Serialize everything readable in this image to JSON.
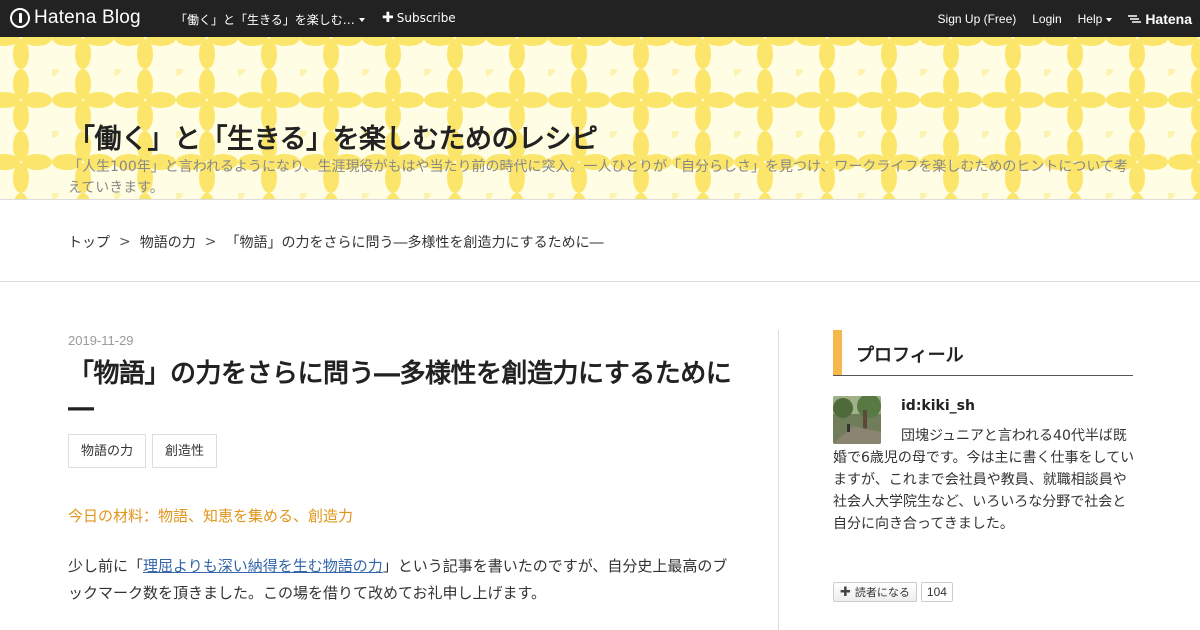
{
  "topbar": {
    "brand": "Hatena Blog",
    "blog_select": "「働く」と「生きる」を楽しむ…",
    "subscribe": "Subscribe",
    "signup": "Sign Up (Free)",
    "login": "Login",
    "help": "Help",
    "hatena": "Hatena"
  },
  "header": {
    "title": "「働く」と「生きる」を楽しむためのレシピ",
    "description": "「人生100年」と言われるようになり、生涯現役がもはや当たり前の時代に突入。一人ひとりが「自分らしさ」を見つけ、ワークライフを楽しむためのヒントについて考えていきます。",
    "pattern_color": "#fbe66b"
  },
  "breadcrumb": {
    "items": [
      "トップ",
      "物語の力",
      "「物語」の力をさらに問う―多様性を創造力にするために―"
    ],
    "separator": ">"
  },
  "entry": {
    "date": "2019-11-29",
    "title": "「物語」の力をさらに問う―多様性を創造力にするために―",
    "tags": [
      "物語の力",
      "創造性"
    ],
    "ingredients": "今日の材料：物語、知恵を集める、創造力",
    "para_before": "少し前に「",
    "para_link": "理屈よりも深い納得を生む物語の力",
    "para_after": "」という記事を書いたのですが、自分史上最高のブックマーク数を頂きました。この場を借りて改めてお礼申し上げます。",
    "accent_color": "#e0951b",
    "link_color": "#3366aa"
  },
  "sidebar": {
    "profile_title": "プロフィール",
    "profile_id": "id:kiki_sh",
    "bio": "団塊ジュニアと言われる40代半ば既婚で6歳児の母です。今は主に書く仕事をしていますが、これまで会社員や教員、就職相談員や社会人大学院生など、いろいろな分野で社会と自分に向き合ってきました。",
    "follow_label": "読者になる",
    "follow_count": "104",
    "bar_color": "#f4b94a"
  }
}
